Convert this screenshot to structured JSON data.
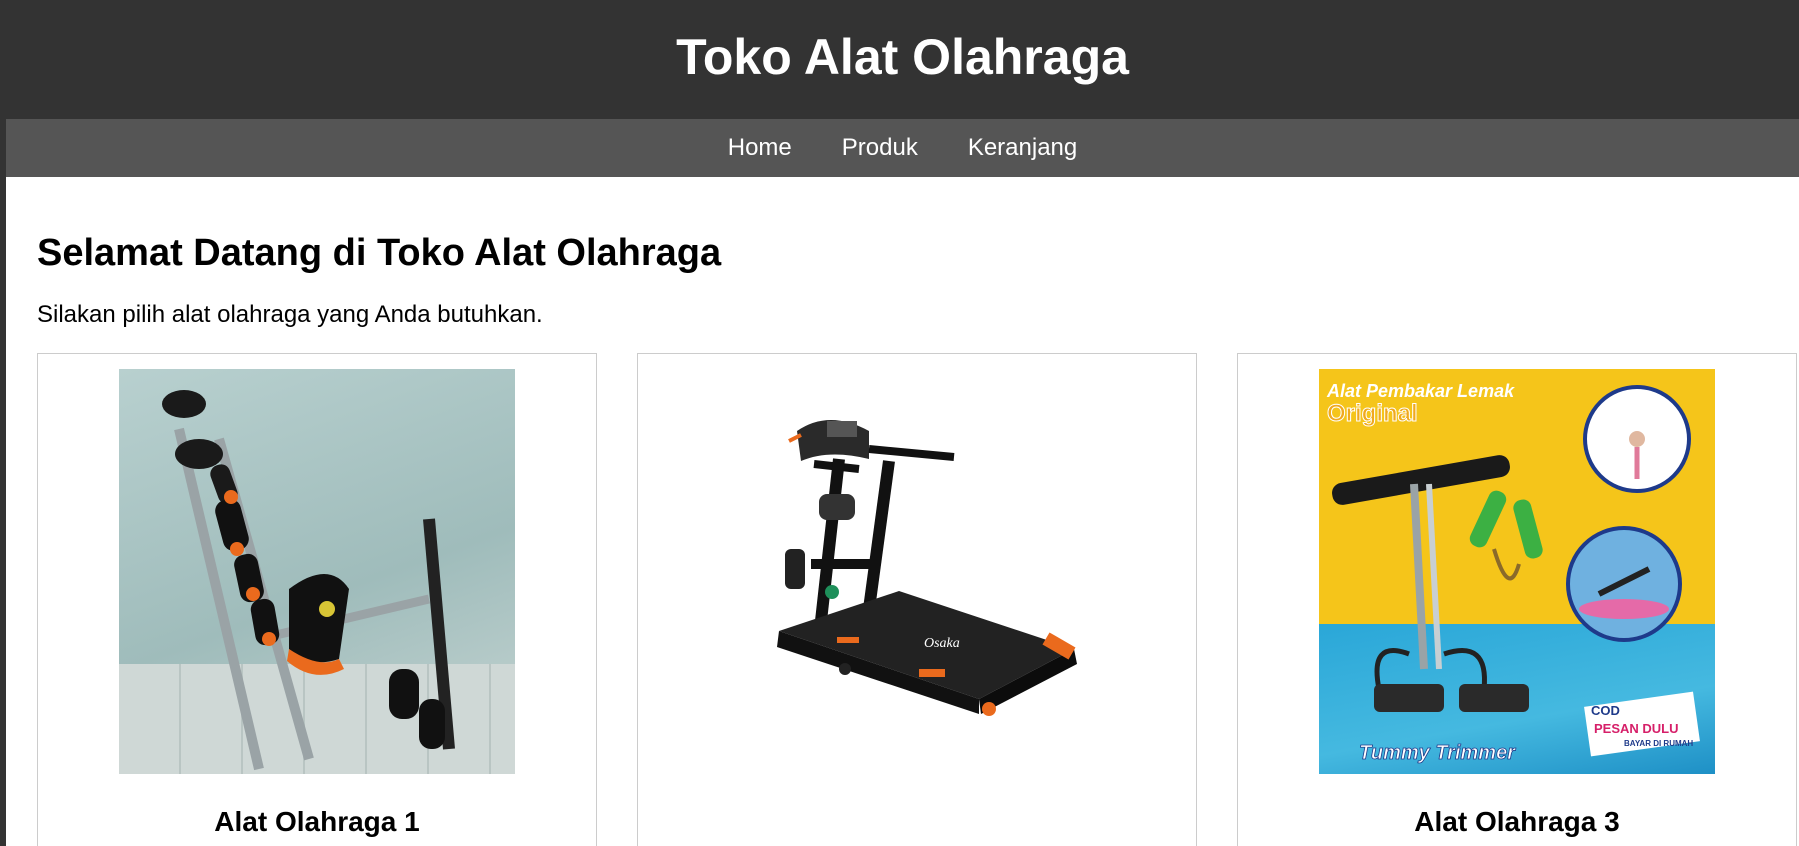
{
  "header": {
    "title": "Toko Alat Olahraga"
  },
  "nav": {
    "items": [
      {
        "label": "Home"
      },
      {
        "label": "Produk"
      },
      {
        "label": "Keranjang"
      }
    ]
  },
  "main": {
    "title": "Selamat Datang di Toko Alat Olahraga",
    "subtitle": "Silakan pilih alat olahraga yang Anda butuhkan."
  },
  "products": [
    {
      "name": "Alat Olahraga 1",
      "image_subject": "six-pack-ab-machine"
    },
    {
      "name": "",
      "image_subject": "treadmill",
      "image_brand_text": "Osaka"
    },
    {
      "name": "Alat Olahraga 3",
      "image_subject": "tummy-trimmer",
      "image_texts": {
        "headline": "Alat Pembakar Lemak",
        "headline_2": "Original",
        "caption": "Tummy Trimmer",
        "badge_1": "COD",
        "badge_2": "PESAN DULU",
        "badge_3": "BAYAR DI RUMAH"
      }
    }
  ],
  "colors": {
    "header_bg": "#333333",
    "nav_bg": "#555555",
    "card_border": "#cccccc"
  }
}
